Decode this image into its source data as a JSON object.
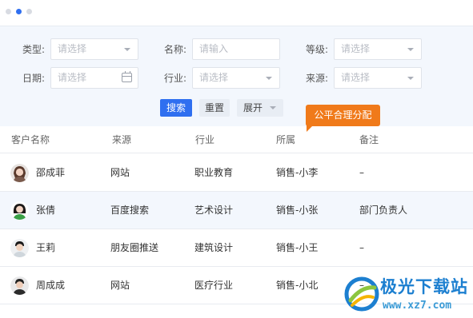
{
  "filters": {
    "row1": [
      {
        "label": "类型:",
        "placeholder": "请选择"
      },
      {
        "label": "名称:",
        "placeholder": "请输入"
      },
      {
        "label": "等级:",
        "placeholder": "请选择"
      }
    ],
    "row2": [
      {
        "label": "日期:",
        "placeholder": "请选择"
      },
      {
        "label": "行业:",
        "placeholder": "请选择"
      },
      {
        "label": "来源:",
        "placeholder": "请选择"
      }
    ]
  },
  "actions": {
    "search_label": "搜索",
    "reset_label": "重置",
    "expand_label": "展开"
  },
  "tooltip": "公平合理分配",
  "table": {
    "headers": [
      "客户名称",
      "来源",
      "行业",
      "所属",
      "备注"
    ],
    "rows": [
      {
        "name": "邵成菲",
        "source": "网站",
        "industry": "职业教育",
        "owner": "销售-小李",
        "note": "–"
      },
      {
        "name": "张倩",
        "source": "百度搜索",
        "industry": "艺术设计",
        "owner": "销售-小张",
        "note": "部门负责人"
      },
      {
        "name": "王莉",
        "source": "朋友圈推送",
        "industry": "建筑设计",
        "owner": "销售-小王",
        "note": "–"
      },
      {
        "name": "周成成",
        "source": "网站",
        "industry": "医疗行业",
        "owner": "销售-小北",
        "note": "–"
      }
    ]
  },
  "watermark": {
    "title": "极光下载站",
    "url": "www.xz7.com"
  },
  "colors": {
    "primary": "#2f6ff0",
    "tooltip": "#f07a1a",
    "panel_bg": "#f3f7fd"
  }
}
